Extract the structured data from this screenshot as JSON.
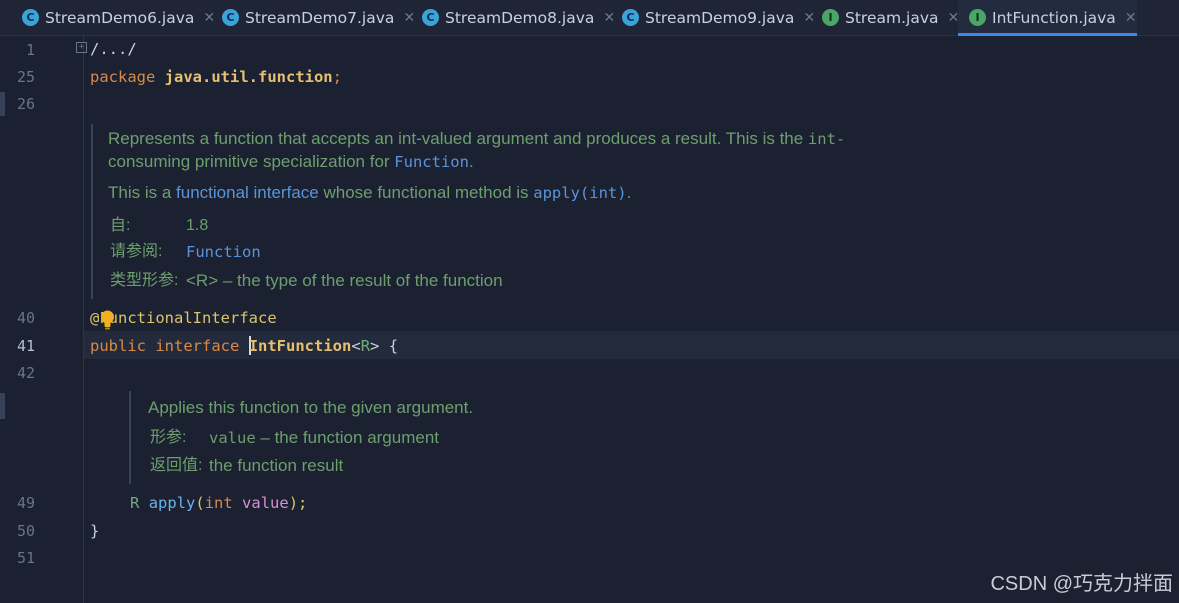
{
  "tabs": [
    {
      "label": "StreamDemo6.java",
      "icon": "class-c-icon",
      "active": false
    },
    {
      "label": "StreamDemo7.java",
      "icon": "class-c-icon",
      "active": false
    },
    {
      "label": "StreamDemo8.java",
      "icon": "class-c-icon",
      "active": false
    },
    {
      "label": "StreamDemo9.java",
      "icon": "class-c-icon",
      "active": false
    },
    {
      "label": "Stream.java",
      "icon": "interface-i-icon",
      "active": false
    },
    {
      "label": "IntFunction.java",
      "icon": "interface-i-icon",
      "active": true
    }
  ],
  "tab_icons": {
    "class_letter": "C",
    "interface_letter": "I",
    "close_glyph": "✕"
  },
  "line_numbers": [
    "1",
    "25",
    "26",
    "40",
    "41",
    "42",
    "49",
    "50",
    "51"
  ],
  "code": {
    "imports_fold": "/.../",
    "fold_toggle": "+",
    "package_kw": "package",
    "package_name": "java.util.function",
    "semicolon": ";",
    "annotation_at": "@",
    "annotation_name": "FunctionalInterface",
    "public_kw": "public",
    "interface_kw": "interface",
    "interface_name": "IntFunction",
    "type_params_open": "<",
    "type_param": "R",
    "type_params_close": ">",
    "open_brace": " {",
    "method_return": "R",
    "method_name": "apply",
    "paren_open": "(",
    "param_type": "int",
    "param_name": "value",
    "paren_close_semicolon": ");",
    "close_brace": "}"
  },
  "interface_doc": {
    "line1_text": "Represents a function that accepts an int-valued argument and produces a result. This is the ",
    "line1_code": "int-",
    "line2_text": "consuming primitive specialization for ",
    "line2_link": "Function",
    "line2_end": ".",
    "line3_text_a": "This is a ",
    "line3_link": "functional interface",
    "line3_text_b": " whose functional method is ",
    "line3_code": "apply(int)",
    "line3_end": ".",
    "since_label": "自:",
    "since_value": "1.8",
    "see_label": "请参阅:",
    "see_value": "Function",
    "typeparams_label": "类型形参:",
    "typeparams_value": "<R> – the type of the result of the function"
  },
  "method_doc": {
    "line1": "Applies this function to the given argument.",
    "params_label": "形参:",
    "param_code": "value",
    "param_desc": " – the function argument",
    "returns_label": "返回值:",
    "returns_value": "the function result"
  },
  "watermark": "CSDN @巧克力拌面",
  "colors": {
    "background": "#1b2130",
    "keyword": "#d98a48",
    "doc_text": "#6d9f6e",
    "doc_link": "#5a94d8",
    "active_tab_underline": "#3b8be6"
  }
}
